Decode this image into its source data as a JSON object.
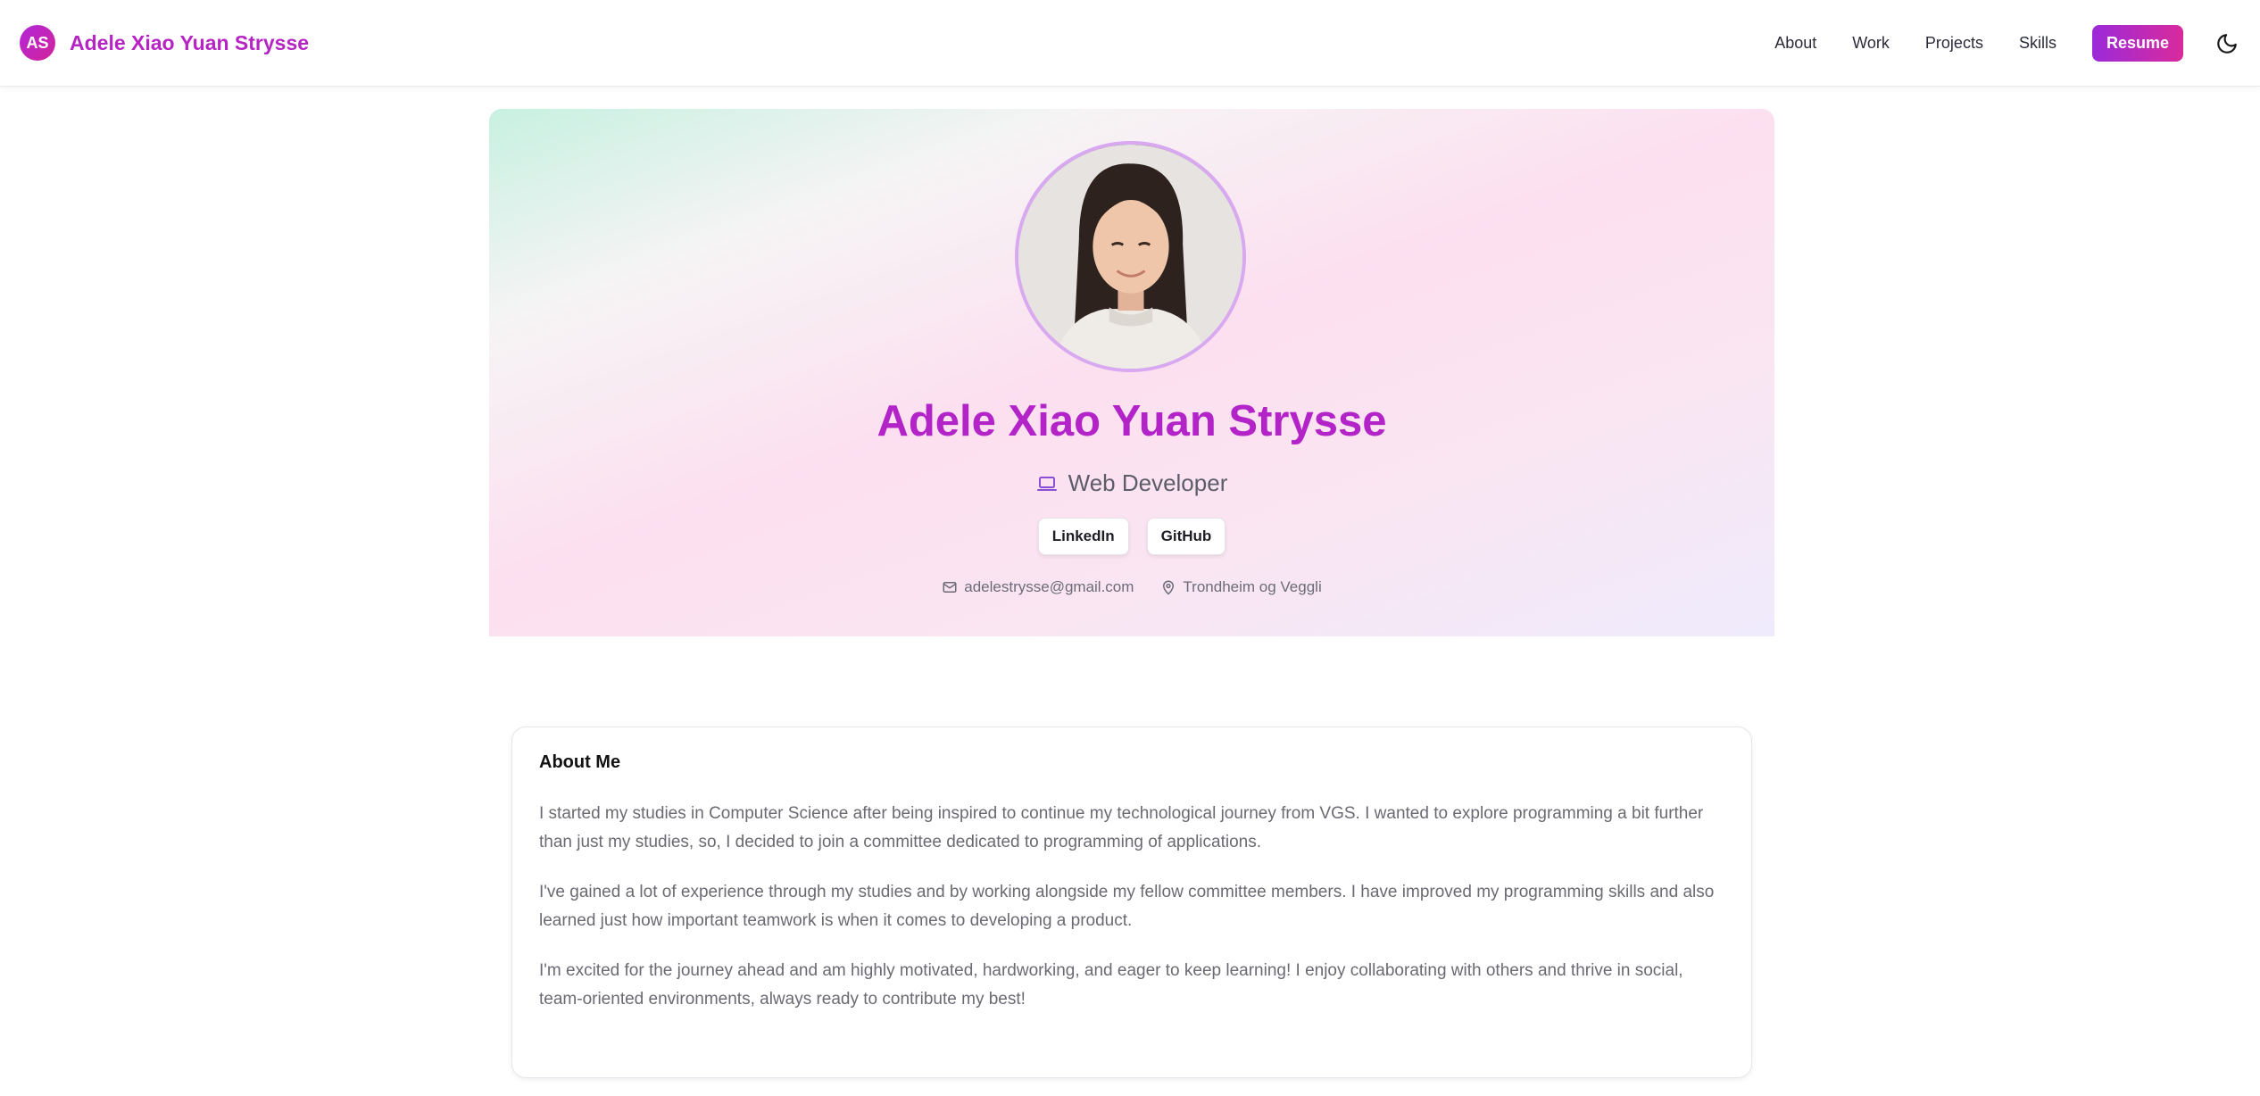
{
  "header": {
    "logo_initials": "AS",
    "brand_name": "Adele Xiao Yuan Strysse",
    "nav": [
      "About",
      "Work",
      "Projects",
      "Skills"
    ],
    "resume_label": "Resume",
    "theme_icon": "moon-icon"
  },
  "hero": {
    "name": "Adele Xiao Yuan Strysse",
    "role": "Web Developer",
    "role_icon": "laptop-icon",
    "links": [
      "LinkedIn",
      "GitHub"
    ],
    "email": "adelestrysse@gmail.com",
    "location": "Trondheim og Veggli"
  },
  "about": {
    "title": "About Me",
    "paragraphs": [
      "I started my studies in Computer Science after being inspired to continue my technological journey from VGS. I wanted to explore programming a bit further than just my studies, so, I decided to join a committee dedicated to programming of applications.",
      "I've gained a lot of experience through my studies and by working alongside my fellow committee members. I have improved my programming skills and also learned just how important teamwork is when it comes to developing a product.",
      "I'm excited for the journey ahead and am highly motivated, hardworking, and eager to keep learning! I enjoy collaborating with others and thrive in social, team-oriented environments, always ready to contribute my best!"
    ]
  },
  "colors": {
    "accent": "#b324c8",
    "resume_gradient_start": "#9b2ad9",
    "resume_gradient_end": "#d92a9c"
  }
}
